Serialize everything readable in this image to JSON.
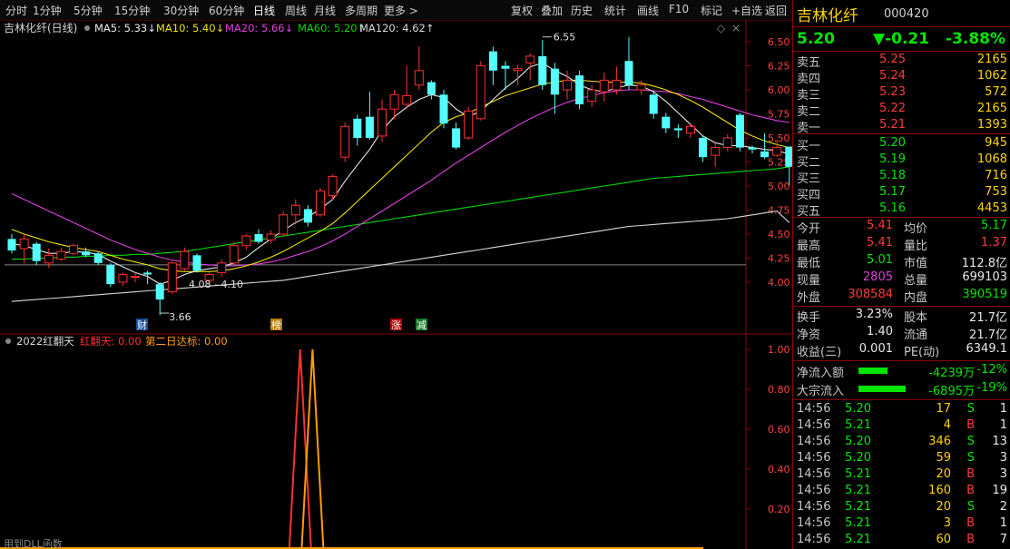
{
  "toolbar": {
    "left": [
      "分时",
      "1分钟",
      "5分钟",
      "15分钟",
      "30分钟",
      "60分钟",
      "日线",
      "周线",
      "月线",
      "多周期",
      "更多 >"
    ],
    "active": "日线",
    "right": [
      "复权",
      "叠加",
      "历史",
      "统计",
      "画线",
      "F10",
      "标记",
      "+自选",
      "返回"
    ]
  },
  "kline": {
    "title": "吉林化纤(日线)",
    "ma": [
      {
        "label": "MA5: 5.33↓",
        "color": "#e8e8e8"
      },
      {
        "label": "MA10: 5.40↓",
        "color": "#f0e000"
      },
      {
        "label": "MA20: 5.66↓",
        "color": "#e040e0"
      },
      {
        "label": "MA60: 5.20↑",
        "color": "#00d800"
      },
      {
        "label": "MA120: 4.62↑",
        "color": "#d8d8d8"
      }
    ],
    "y_ticks": [
      "6.50",
      "6.25",
      "6.00",
      "5.75",
      "5.50",
      "5.25",
      "5.00",
      "4.75",
      "4.50",
      "4.25",
      "4.00"
    ],
    "high_label": "6.55",
    "low_label": "3.66",
    "range_label": "4.08 - 4.10",
    "markers": [
      "财",
      "榜",
      "涨",
      "减"
    ]
  },
  "indicator": {
    "title": "2022红翻天",
    "line1": "红翻天: 0.00",
    "line2": "第二日达标: 0.00",
    "y_ticks": [
      "1.00",
      "0.80",
      "0.60",
      "0.40",
      "0.20"
    ],
    "footer": "用到DLL函数"
  },
  "chart_data": {
    "type": "candlestick",
    "ylim": [
      3.66,
      6.55
    ],
    "candles": [
      {
        "o": 4.45,
        "c": 4.33,
        "h": 4.5,
        "l": 4.3,
        "up": false
      },
      {
        "o": 4.35,
        "c": 4.45,
        "h": 4.5,
        "l": 4.2,
        "up": true
      },
      {
        "o": 4.4,
        "c": 4.22,
        "h": 4.42,
        "l": 4.18,
        "up": false
      },
      {
        "o": 4.2,
        "c": 4.28,
        "h": 4.35,
        "l": 4.15,
        "up": true
      },
      {
        "o": 4.24,
        "c": 4.32,
        "h": 4.36,
        "l": 4.22,
        "up": true
      },
      {
        "o": 4.3,
        "c": 4.38,
        "h": 4.4,
        "l": 4.28,
        "up": true
      },
      {
        "o": 4.32,
        "c": 4.28,
        "h": 4.36,
        "l": 4.26,
        "up": false
      },
      {
        "o": 4.3,
        "c": 4.2,
        "h": 4.32,
        "l": 4.18,
        "up": false
      },
      {
        "o": 4.18,
        "c": 3.98,
        "h": 4.2,
        "l": 3.95,
        "up": false
      },
      {
        "o": 4.0,
        "c": 4.08,
        "h": 4.1,
        "l": 3.96,
        "up": true
      },
      {
        "o": 4.05,
        "c": 4.06,
        "h": 4.1,
        "l": 4.0,
        "up": true
      },
      {
        "o": 4.1,
        "c": 4.08,
        "h": 4.12,
        "l": 3.98,
        "up": false
      },
      {
        "o": 3.98,
        "c": 3.82,
        "h": 4.0,
        "l": 3.66,
        "up": false
      },
      {
        "o": 3.9,
        "c": 4.2,
        "h": 4.22,
        "l": 3.88,
        "up": true
      },
      {
        "o": 4.14,
        "c": 4.32,
        "h": 4.36,
        "l": 4.12,
        "up": true
      },
      {
        "o": 4.28,
        "c": 4.12,
        "h": 4.3,
        "l": 4.1,
        "up": false
      },
      {
        "o": 4.02,
        "c": 4.08,
        "h": 4.1,
        "l": 3.98,
        "up": true
      },
      {
        "o": 4.1,
        "c": 4.2,
        "h": 4.24,
        "l": 4.06,
        "up": true
      },
      {
        "o": 4.2,
        "c": 4.38,
        "h": 4.42,
        "l": 4.18,
        "up": true
      },
      {
        "o": 4.38,
        "c": 4.48,
        "h": 4.5,
        "l": 4.34,
        "up": true
      },
      {
        "o": 4.42,
        "c": 4.5,
        "h": 4.55,
        "l": 4.4,
        "up": false
      },
      {
        "o": 4.44,
        "c": 4.5,
        "h": 4.54,
        "l": 4.4,
        "up": true
      },
      {
        "o": 4.5,
        "c": 4.7,
        "h": 4.74,
        "l": 4.48,
        "up": true
      },
      {
        "o": 4.7,
        "c": 4.8,
        "h": 4.86,
        "l": 4.6,
        "up": true
      },
      {
        "o": 4.76,
        "c": 4.62,
        "h": 4.8,
        "l": 4.58,
        "up": false
      },
      {
        "o": 4.7,
        "c": 4.95,
        "h": 4.98,
        "l": 4.68,
        "up": true
      },
      {
        "o": 4.9,
        "c": 5.1,
        "h": 5.12,
        "l": 4.86,
        "up": true
      },
      {
        "o": 5.3,
        "c": 5.62,
        "h": 5.66,
        "l": 5.25,
        "up": true
      },
      {
        "o": 5.5,
        "c": 5.7,
        "h": 5.74,
        "l": 5.42,
        "up": false
      },
      {
        "o": 5.72,
        "c": 5.5,
        "h": 5.98,
        "l": 5.48,
        "up": false
      },
      {
        "o": 5.52,
        "c": 5.8,
        "h": 5.9,
        "l": 5.46,
        "up": true
      },
      {
        "o": 5.8,
        "c": 5.95,
        "h": 6.0,
        "l": 5.7,
        "up": true
      },
      {
        "o": 5.94,
        "c": 5.85,
        "h": 6.25,
        "l": 5.8,
        "up": true
      },
      {
        "o": 6.05,
        "c": 6.2,
        "h": 6.45,
        "l": 6.0,
        "up": true
      },
      {
        "o": 6.08,
        "c": 5.95,
        "h": 6.1,
        "l": 5.9,
        "up": false
      },
      {
        "o": 5.95,
        "c": 5.65,
        "h": 6.0,
        "l": 5.6,
        "up": false
      },
      {
        "o": 5.6,
        "c": 5.4,
        "h": 5.66,
        "l": 5.38,
        "up": false
      },
      {
        "o": 5.5,
        "c": 5.78,
        "h": 5.82,
        "l": 5.48,
        "up": true
      },
      {
        "o": 5.7,
        "c": 6.25,
        "h": 6.3,
        "l": 5.68,
        "up": true
      },
      {
        "o": 6.2,
        "c": 6.4,
        "h": 6.45,
        "l": 6.05,
        "up": false
      },
      {
        "o": 6.25,
        "c": 6.22,
        "h": 6.3,
        "l": 6.0,
        "up": false
      },
      {
        "o": 6.22,
        "c": 6.2,
        "h": 6.26,
        "l": 6.05,
        "up": true
      },
      {
        "o": 6.28,
        "c": 6.35,
        "h": 6.38,
        "l": 6.1,
        "up": true
      },
      {
        "o": 6.35,
        "c": 6.05,
        "h": 6.52,
        "l": 6.0,
        "up": false
      },
      {
        "o": 6.22,
        "c": 5.95,
        "h": 6.28,
        "l": 5.75,
        "up": false
      },
      {
        "o": 6.0,
        "c": 6.1,
        "h": 6.2,
        "l": 5.9,
        "up": true
      },
      {
        "o": 6.15,
        "c": 5.85,
        "h": 6.2,
        "l": 5.8,
        "up": false
      },
      {
        "o": 5.88,
        "c": 6.0,
        "h": 6.05,
        "l": 5.82,
        "up": true
      },
      {
        "o": 5.98,
        "c": 6.1,
        "h": 6.18,
        "l": 5.88,
        "up": true
      },
      {
        "o": 6.1,
        "c": 6.0,
        "h": 6.24,
        "l": 5.95,
        "up": true
      },
      {
        "o": 6.3,
        "c": 6.05,
        "h": 6.55,
        "l": 6.0,
        "up": false
      },
      {
        "o": 6.05,
        "c": 6.0,
        "h": 6.1,
        "l": 5.95,
        "up": true
      },
      {
        "o": 5.95,
        "c": 5.75,
        "h": 5.98,
        "l": 5.7,
        "up": false
      },
      {
        "o": 5.72,
        "c": 5.6,
        "h": 5.76,
        "l": 5.55,
        "up": false
      },
      {
        "o": 5.6,
        "c": 5.58,
        "h": 5.64,
        "l": 5.5,
        "up": false
      },
      {
        "o": 5.62,
        "c": 5.55,
        "h": 5.65,
        "l": 5.5,
        "up": true
      },
      {
        "o": 5.5,
        "c": 5.3,
        "h": 5.52,
        "l": 5.25,
        "up": false
      },
      {
        "o": 5.32,
        "c": 5.4,
        "h": 5.45,
        "l": 5.2,
        "up": true
      },
      {
        "o": 5.4,
        "c": 5.5,
        "h": 5.54,
        "l": 5.36,
        "up": true
      },
      {
        "o": 5.74,
        "c": 5.4,
        "h": 5.76,
        "l": 5.36,
        "up": false
      },
      {
        "o": 5.4,
        "c": 5.38,
        "h": 5.42,
        "l": 5.34,
        "up": false
      },
      {
        "o": 5.36,
        "c": 5.3,
        "h": 5.55,
        "l": 5.28,
        "up": false
      },
      {
        "o": 5.32,
        "c": 5.4,
        "h": 5.48,
        "l": 5.3,
        "up": true
      },
      {
        "o": 5.41,
        "c": 5.2,
        "h": 5.41,
        "l": 5.01,
        "up": false
      }
    ],
    "ma5": [
      4.4,
      4.38,
      4.34,
      4.3,
      4.3,
      4.32,
      4.31,
      4.29,
      4.22,
      4.16,
      4.1,
      4.06,
      3.98,
      4.02,
      4.08,
      4.12,
      4.14,
      4.16,
      4.2,
      4.26,
      4.36,
      4.45,
      4.54,
      4.62,
      4.68,
      4.76,
      4.86,
      5.05,
      5.22,
      5.38,
      5.58,
      5.72,
      5.82,
      5.9,
      5.95,
      5.92,
      5.8,
      5.72,
      5.78,
      5.9,
      6.02,
      6.12,
      6.24,
      6.28,
      6.2,
      6.14,
      6.05,
      6.0,
      5.98,
      6.02,
      6.05,
      6.04,
      5.98,
      5.88,
      5.76,
      5.64,
      5.52,
      5.45,
      5.42,
      5.42,
      5.4,
      5.38,
      5.37,
      5.33
    ],
    "ma10": [
      4.55,
      4.5,
      4.46,
      4.42,
      4.39,
      4.36,
      4.34,
      4.32,
      4.28,
      4.24,
      4.21,
      4.18,
      4.14,
      4.12,
      4.11,
      4.11,
      4.11,
      4.12,
      4.14,
      4.17,
      4.21,
      4.26,
      4.32,
      4.39,
      4.46,
      4.53,
      4.61,
      4.72,
      4.84,
      4.96,
      5.08,
      5.2,
      5.32,
      5.44,
      5.56,
      5.66,
      5.72,
      5.76,
      5.82,
      5.88,
      5.94,
      5.98,
      6.02,
      6.06,
      6.08,
      6.1,
      6.1,
      6.09,
      6.08,
      6.08,
      6.08,
      6.07,
      6.04,
      6.0,
      5.95,
      5.89,
      5.82,
      5.74,
      5.66,
      5.58,
      5.52,
      5.47,
      5.43,
      5.4
    ],
    "ma20": [
      4.92,
      4.86,
      4.8,
      4.74,
      4.68,
      4.62,
      4.56,
      4.5,
      4.44,
      4.39,
      4.34,
      4.3,
      4.26,
      4.23,
      4.21,
      4.19,
      4.18,
      4.17,
      4.17,
      4.18,
      4.19,
      4.21,
      4.24,
      4.28,
      4.32,
      4.37,
      4.43,
      4.5,
      4.58,
      4.66,
      4.74,
      4.82,
      4.9,
      4.98,
      5.06,
      5.15,
      5.24,
      5.32,
      5.4,
      5.48,
      5.56,
      5.63,
      5.7,
      5.76,
      5.82,
      5.87,
      5.91,
      5.94,
      5.97,
      5.99,
      6.0,
      6.0,
      5.99,
      5.98,
      5.96,
      5.93,
      5.9,
      5.86,
      5.82,
      5.78,
      5.74,
      5.71,
      5.68,
      5.66
    ],
    "ma60": [
      4.24,
      4.24,
      4.25,
      4.25,
      4.26,
      4.26,
      4.27,
      4.27,
      4.28,
      4.28,
      4.29,
      4.29,
      4.3,
      4.31,
      4.32,
      4.34,
      4.36,
      4.38,
      4.4,
      4.42,
      4.44,
      4.46,
      4.48,
      4.5,
      4.52,
      4.54,
      4.56,
      4.58,
      4.6,
      4.62,
      4.64,
      4.66,
      4.68,
      4.7,
      4.72,
      4.74,
      4.76,
      4.78,
      4.8,
      4.82,
      4.84,
      4.86,
      4.88,
      4.9,
      4.92,
      4.94,
      4.96,
      4.98,
      5.0,
      5.02,
      5.04,
      5.06,
      5.08,
      5.09,
      5.1,
      5.11,
      5.12,
      5.13,
      5.14,
      5.15,
      5.16,
      5.17,
      5.18,
      5.2
    ],
    "ma120": [
      3.8,
      3.81,
      3.82,
      3.83,
      3.84,
      3.85,
      3.86,
      3.87,
      3.88,
      3.89,
      3.9,
      3.91,
      3.92,
      3.93,
      3.94,
      3.95,
      3.96,
      3.97,
      3.98,
      3.99,
      4.0,
      4.01,
      4.02,
      4.04,
      4.06,
      4.08,
      4.1,
      4.12,
      4.14,
      4.16,
      4.18,
      4.2,
      4.22,
      4.24,
      4.26,
      4.28,
      4.3,
      4.32,
      4.34,
      4.36,
      4.38,
      4.4,
      4.42,
      4.44,
      4.46,
      4.48,
      4.5,
      4.52,
      4.54,
      4.56,
      4.58,
      4.59,
      4.6,
      4.61,
      4.62,
      4.63,
      4.64,
      4.65,
      4.66,
      4.68,
      4.7,
      4.72,
      4.74,
      4.62
    ],
    "ref_line": 4.18,
    "indicator_spikes": [
      {
        "index": 23,
        "value": 1.0,
        "color": "#ff3030"
      },
      {
        "index": 24,
        "value": 1.0,
        "color": "#ff9d00"
      }
    ]
  },
  "quote": {
    "name": "吉林化纤",
    "code": "000420",
    "price": "5.20",
    "change": "▼-0.21",
    "pct": "-3.88%",
    "asks": [
      {
        "label": "卖五",
        "price": "5.25",
        "vol": "2165"
      },
      {
        "label": "卖四",
        "price": "5.24",
        "vol": "1062"
      },
      {
        "label": "卖三",
        "price": "5.23",
        "vol": "572"
      },
      {
        "label": "卖二",
        "price": "5.22",
        "vol": "2165"
      },
      {
        "label": "卖一",
        "price": "5.21",
        "vol": "1393"
      }
    ],
    "bids": [
      {
        "label": "买一",
        "price": "5.20",
        "vol": "945"
      },
      {
        "label": "买二",
        "price": "5.19",
        "vol": "1068"
      },
      {
        "label": "买三",
        "price": "5.18",
        "vol": "716"
      },
      {
        "label": "买四",
        "price": "5.17",
        "vol": "753"
      },
      {
        "label": "买五",
        "price": "5.16",
        "vol": "4453"
      }
    ],
    "stats1": [
      {
        "l1": "今开",
        "v1": "5.41",
        "c1": "red",
        "l2": "均价",
        "v2": "5.17",
        "c2": "green"
      },
      {
        "l1": "最高",
        "v1": "5.41",
        "c1": "red",
        "l2": "量比",
        "v2": "1.37",
        "c2": "red"
      },
      {
        "l1": "最低",
        "v1": "5.01",
        "c1": "green",
        "l2": "市值",
        "v2": "112.8亿",
        "c2": "white"
      },
      {
        "l1": "现量",
        "v1": "2805",
        "c1": "magenta",
        "l2": "总量",
        "v2": "699103",
        "c2": "white"
      },
      {
        "l1": "外盘",
        "v1": "308584",
        "c1": "red",
        "l2": "内盘",
        "v2": "390519",
        "c2": "green"
      }
    ],
    "stats2": [
      {
        "l1": "换手",
        "v1": "3.23%",
        "l2": "股本",
        "v2": "21.7亿"
      },
      {
        "l1": "净资",
        "v1": "1.40",
        "l2": "流通",
        "v2": "21.7亿"
      },
      {
        "l1": "收益(三)",
        "v1": "0.001",
        "l2": "PE(动)",
        "v2": "6349.1"
      }
    ],
    "flows": [
      {
        "label": "净流入额",
        "value": "-4239万",
        "pct": "-12%"
      },
      {
        "label": "大宗流入",
        "value": "-6895万",
        "pct": "-19%"
      }
    ],
    "ticks": [
      {
        "time": "14:56",
        "price": "5.20",
        "pc": "green",
        "vol": "17",
        "bs": "S",
        "n": "1"
      },
      {
        "time": "14:56",
        "price": "5.21",
        "pc": "green",
        "vol": "4",
        "bs": "B",
        "n": "1"
      },
      {
        "time": "14:56",
        "price": "5.20",
        "pc": "green",
        "vol": "346",
        "bs": "S",
        "n": "13"
      },
      {
        "time": "14:56",
        "price": "5.20",
        "pc": "green",
        "vol": "59",
        "bs": "S",
        "n": "3"
      },
      {
        "time": "14:56",
        "price": "5.21",
        "pc": "green",
        "vol": "20",
        "bs": "B",
        "n": "3"
      },
      {
        "time": "14:56",
        "price": "5.21",
        "pc": "green",
        "vol": "160",
        "bs": "B",
        "n": "19"
      },
      {
        "time": "14:56",
        "price": "5.21",
        "pc": "green",
        "vol": "20",
        "bs": "S",
        "n": "2"
      },
      {
        "time": "14:56",
        "price": "5.21",
        "pc": "green",
        "vol": "3",
        "bs": "B",
        "n": "1"
      },
      {
        "time": "14:56",
        "price": "5.21",
        "pc": "green",
        "vol": "60",
        "bs": "B",
        "n": "7"
      }
    ]
  }
}
